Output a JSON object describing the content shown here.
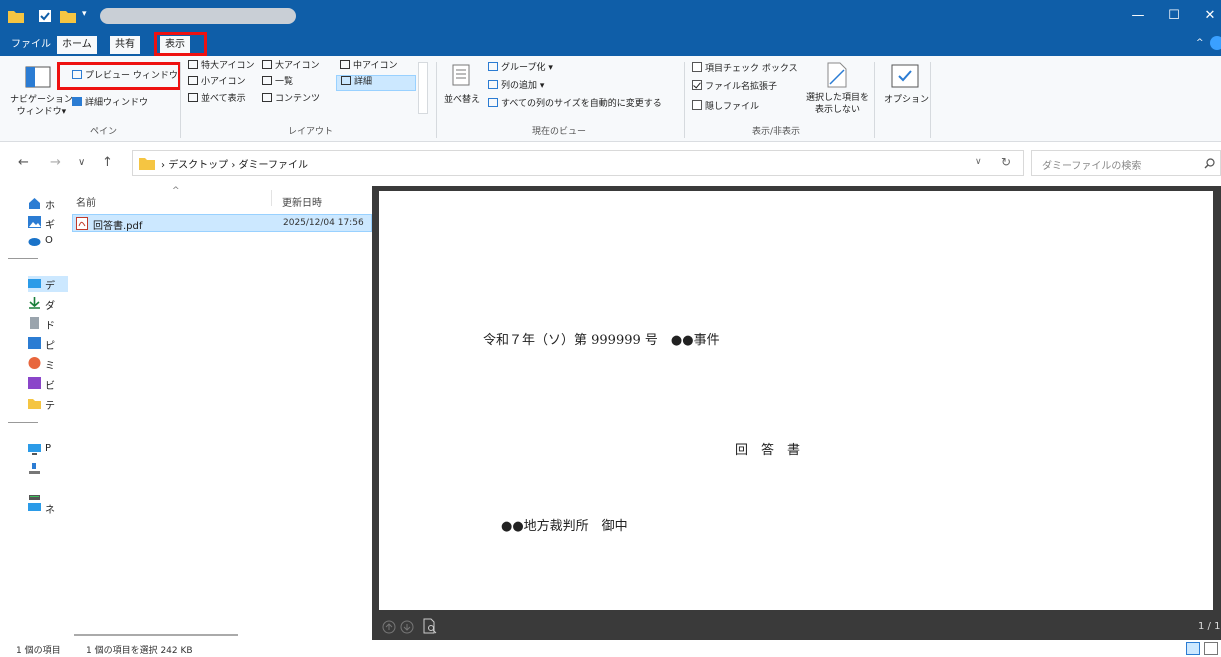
{
  "ribbon_tabs": [
    {
      "label": "ファイル"
    },
    {
      "label": "ホーム"
    },
    {
      "label": "共有"
    },
    {
      "label": "表示"
    }
  ],
  "ribbon": {
    "panes": {
      "nav_pane_label": "ナビゲーション\nウィンドウ▾",
      "preview_pane": "プレビュー ウィンドウ",
      "details_pane": "詳細ウィンドウ",
      "group_label": "ペイン"
    },
    "layout": {
      "extra_large": "特大アイコン",
      "large": "大アイコン",
      "medium": "中アイコン",
      "small": "小アイコン",
      "list": "一覧",
      "details": "詳細",
      "tiles": "並べて表示",
      "content": "コンテンツ",
      "group_label": "レイアウト"
    },
    "current_view": {
      "sort": "並べ替え",
      "group_by": "グループ化 ▾",
      "add_columns": "列の追加 ▾",
      "size_all": "すべての列のサイズを自動的に変更する",
      "group_label": "現在のビュー"
    },
    "show_hide": {
      "item_checkboxes": "項目チェック ボックス",
      "file_extensions": "ファイル名拡張子",
      "hidden_items": "隠しファイル",
      "hide_selected": "選択した項目を\n表示しない",
      "group_label": "表示/非表示"
    },
    "options": "オプション"
  },
  "address": {
    "path": [
      "デスクトップ",
      "ダミーファイル"
    ],
    "search_placeholder": "ダミーファイルの検索"
  },
  "nav_items": [
    {
      "label": "ホ"
    },
    {
      "label": "ギ"
    },
    {
      "label": "O"
    },
    {
      "label": "デ"
    },
    {
      "label": "ダ"
    },
    {
      "label": "ド"
    },
    {
      "label": "ピ"
    },
    {
      "label": "ミ"
    },
    {
      "label": "ビ"
    },
    {
      "label": "テ"
    },
    {
      "label": "P"
    },
    {
      "label": "ネ"
    }
  ],
  "file_list": {
    "col_name": "名前",
    "col_modified": "更新日時",
    "rows": [
      {
        "name": "回答書.pdf",
        "modified": "2025/12/04 17:56"
      }
    ]
  },
  "preview_doc": {
    "case_line": "令和７年（ソ）第 999999 号　●●事件",
    "doc_title": "回　答　書",
    "addressee": "●●地方裁判所　御中",
    "page_indicator": "1 / 1"
  },
  "status": {
    "item_count": "1 個の項目",
    "selected": "1 個の項目を選択 242 KB"
  },
  "colors": {
    "titlebar": "#0f5ea8",
    "highlight_box": "#ee1111",
    "selection": "#cce8ff"
  }
}
